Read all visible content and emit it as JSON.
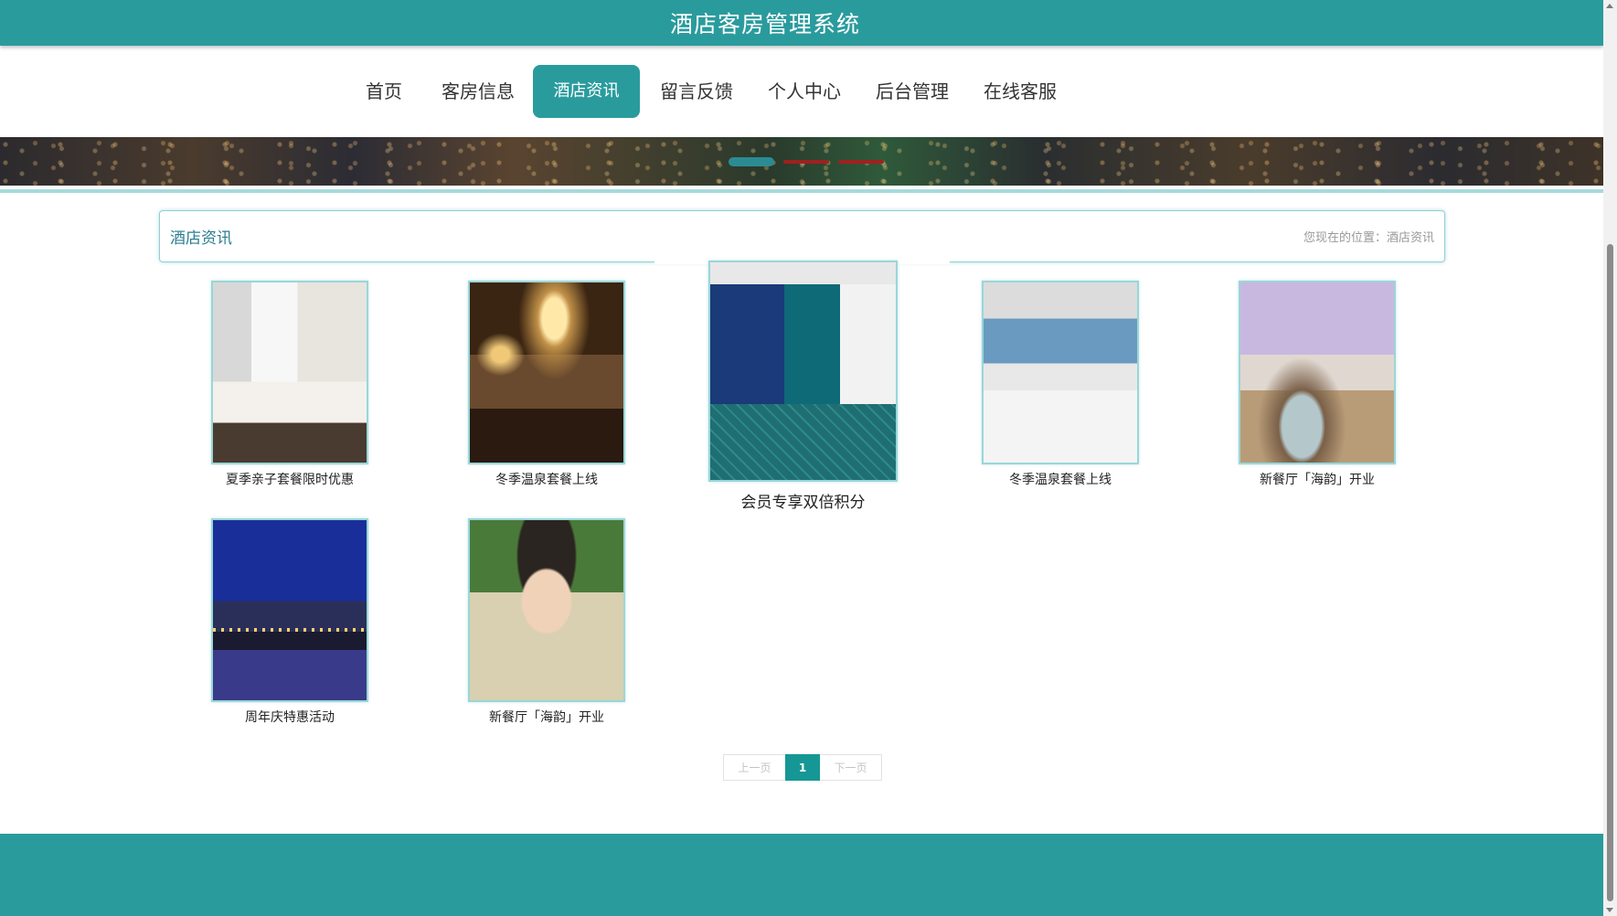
{
  "header": {
    "title": "酒店客房管理系统"
  },
  "nav": {
    "items": [
      {
        "label": "首页",
        "active": false
      },
      {
        "label": "客房信息",
        "active": false
      },
      {
        "label": "酒店资讯",
        "active": true
      },
      {
        "label": "留言反馈",
        "active": false
      },
      {
        "label": "个人中心",
        "active": false
      },
      {
        "label": "后台管理",
        "active": false
      },
      {
        "label": "在线客服",
        "active": false
      }
    ]
  },
  "banner": {
    "slide_count": 3,
    "active_slide": 1
  },
  "section": {
    "title": "酒店资讯",
    "breadcrumb": "您现在的位置：酒店资讯"
  },
  "news": [
    {
      "caption": "夏季亲子套餐限时优惠",
      "image": "hotel-room-photo"
    },
    {
      "caption": "冬季温泉套餐上线",
      "image": "banquet-hall-photo"
    },
    {
      "caption": "会员专享双倍积分",
      "image": "luxury-suite-photo"
    },
    {
      "caption": "冬季温泉套餐上线",
      "image": "hotel-room-photo"
    },
    {
      "caption": "新餐厅「海韵」开业",
      "image": "spa-suite-photo"
    },
    {
      "caption": "周年庆特惠活动",
      "image": "city-night-photo"
    },
    {
      "caption": "新餐厅「海韵」开业",
      "image": "portrait-photo"
    }
  ],
  "pagination": {
    "prev": "上一页",
    "current": "1",
    "next": "下一页"
  },
  "colors": {
    "primary": "#2a9b9d",
    "pager_active": "#159796",
    "accent_border": "#8fd0d4"
  }
}
